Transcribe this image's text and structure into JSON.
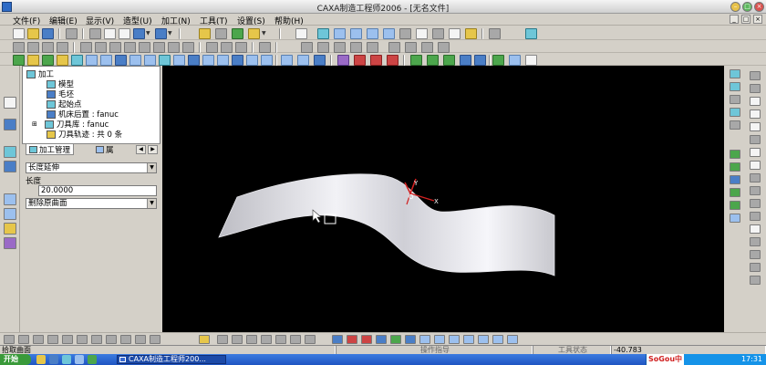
{
  "window": {
    "title": "CAXA制造工程师2006 - [无名文件]",
    "controls": [
      "minimize",
      "maximize",
      "close"
    ]
  },
  "menu": [
    "文件(F)",
    "编辑(E)",
    "显示(V)",
    "造型(U)",
    "加工(N)",
    "工具(T)",
    "设置(S)",
    "帮助(H)"
  ],
  "tree": {
    "root": "加工",
    "children": [
      {
        "label": "模型",
        "icon": "model-icon"
      },
      {
        "label": "毛坯",
        "icon": "stock-icon"
      },
      {
        "label": "起始点",
        "icon": "start-point-icon"
      },
      {
        "label": "机床后置 : fanuc",
        "icon": "machine-post-icon"
      },
      {
        "label": "刀具库 : fanuc",
        "icon": "tool-library-icon"
      },
      {
        "label": "刀具轨迹 : 共 0 条",
        "icon": "toolpath-folder-icon"
      }
    ]
  },
  "tabs": {
    "active": "加工管理",
    "second": "属"
  },
  "properties": {
    "mode_select": "长度延伸",
    "length_label": "长度",
    "length_value": "20.0000",
    "delete_select": "删除原曲面"
  },
  "viewport": {
    "background": "#000000",
    "surface_color": "#e8e8ee",
    "axis_labels": {
      "y": "Y",
      "o": "O",
      "x": "X"
    }
  },
  "status": {
    "prompt": "拾取曲面",
    "operation_label": "操作指导",
    "tool_status_label": "工具状态",
    "coordinate": "-40.783"
  },
  "taskbar": {
    "start": "开始",
    "task_item": "CAXA制造工程师200...",
    "ime": "SoGou中",
    "clock": "17:31"
  },
  "colors": {
    "accent_blue": "#2e6bc6",
    "taskbar_blue": "#1f55c2",
    "axis_red": "#d02020"
  }
}
